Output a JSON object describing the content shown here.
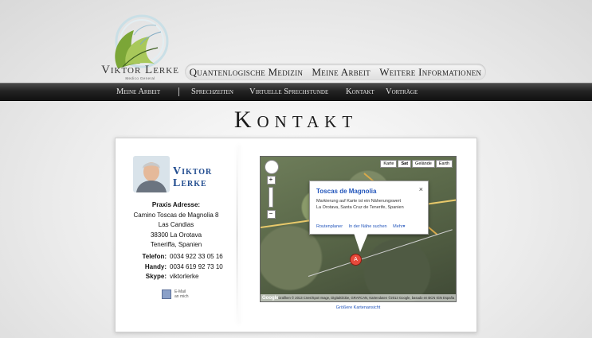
{
  "logo": {
    "name": "Viktor Lerke",
    "subtitle": "Medico General"
  },
  "top_nav": {
    "items": [
      {
        "label": "Quantenlogische Medizin"
      },
      {
        "label": "Meine Arbeit"
      },
      {
        "label": "Weitere Informationen"
      }
    ]
  },
  "sub_nav": {
    "items": [
      {
        "label": "Meine Arbeit"
      },
      {
        "label": "Sprechzeiten"
      },
      {
        "label": "Virtuelle Sprechstunde"
      },
      {
        "label": "Kontakt"
      },
      {
        "label": "Vorträge"
      }
    ]
  },
  "page_title": "Kontakt",
  "contact": {
    "name_line1": "Viktor",
    "name_line2": "Lerke",
    "address_heading": "Praxis Adresse:",
    "address_lines": [
      "Camino Toscas de Magnolia 8",
      "Las Candias",
      "38300 La Orotava",
      "Teneriffa, Spanien"
    ],
    "telefon_label": "Telefon:",
    "telefon": "0034 922 33 05 16",
    "handy_label": "Handy:",
    "handy": "0034 619 92 73 10",
    "skype_label": "Skype:",
    "skype": "viktorlerke",
    "email_line1": "E-Mail",
    "email_line2": "an mich"
  },
  "map": {
    "type_buttons": [
      "Karte",
      "Sat",
      "Gelände",
      "Earth"
    ],
    "active_type": "Sat",
    "info_title": "Toscas de Magnolia",
    "info_desc1": "Markierung auf Karte ist ein Näherungswert",
    "info_desc2": "La Orotava, Santa Cruz de Tenerife, Spanien",
    "info_links": [
      "Routenplaner",
      "In der Nähe suchen",
      "Mehr▾"
    ],
    "marker_label": "A",
    "footer": "Grafiken © 2013 Cnes/Spot Image, DigitalGlobe, GRAFCAN, Kartendaten ©2013 Google, basado en BCN IGN España",
    "larger_map": "Größere Kartenansicht"
  }
}
